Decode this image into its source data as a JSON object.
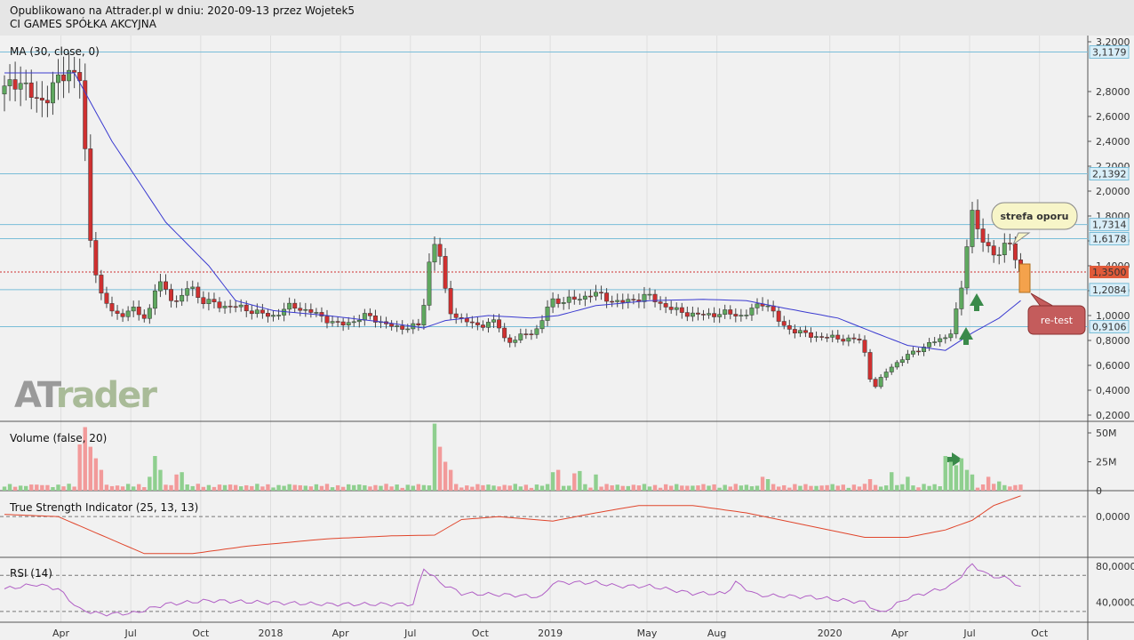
{
  "header": {
    "line1": "Opublikowano na Attrader.pl w dniu: 2020-09-13 przez Wojetek5",
    "line2": "CI GAMES SPÓŁKA AKCYJNA"
  },
  "logo": {
    "text_a": "AT",
    "text_b": "Trader"
  },
  "colors": {
    "up": "#5fa85f",
    "down": "#d03030",
    "vol_up": "#8fcf8f",
    "vol_down": "#f29a9a",
    "ma": "#3a3ad0",
    "tsi": "#e0452b",
    "rsi": "#b05fc5",
    "hline": "#79bdd8",
    "price_line": "#d03030"
  },
  "annotations": {
    "resistance": "strefa oporu",
    "retest": "re-test"
  },
  "chart_data": [
    {
      "type": "candlestick",
      "title": "MA (30, close, 0)",
      "y_ticks": [
        "3,2000",
        "2,8000",
        "2,6000",
        "2,4000",
        "2,2000",
        "2,0000",
        "1,8000",
        "1,6000",
        "1,4000",
        "1,2000",
        "1,0000",
        "0,8000",
        "0,6000",
        "0,4000",
        "0,2000"
      ],
      "y_tick_values": [
        3.2,
        2.8,
        2.6,
        2.4,
        2.2,
        2.0,
        1.8,
        1.6,
        1.4,
        1.2,
        1.0,
        0.8,
        0.6,
        0.4,
        0.2
      ],
      "ylim": [
        0.15,
        3.25
      ],
      "x_ticks": [
        "Apr",
        "Jul",
        "Oct",
        "2018",
        "Apr",
        "Jul",
        "Oct",
        "2019",
        "May",
        "Aug",
        "2020",
        "Apr",
        "Jul",
        "Oct"
      ],
      "x_tick_weeks": [
        11,
        24,
        37,
        50,
        63,
        76,
        89,
        102,
        120,
        133,
        154,
        167,
        180,
        193
      ],
      "level_labels": [
        "3,1179",
        "2,1392",
        "1,7314",
        "1,6178",
        "1,2084",
        "0,9106"
      ],
      "level_values": [
        3.1179,
        2.1392,
        1.7314,
        1.6178,
        1.2084,
        0.9106
      ],
      "current_price_label": "1,3500",
      "current_price": 1.35,
      "weeks": 190,
      "anchors": [
        [
          0,
          2.78
        ],
        [
          3,
          2.92
        ],
        [
          6,
          2.72
        ],
        [
          9,
          2.78
        ],
        [
          11,
          2.92
        ],
        [
          13,
          3.0
        ],
        [
          15,
          2.85
        ],
        [
          16,
          1.72
        ],
        [
          17,
          1.52
        ],
        [
          18,
          1.2
        ],
        [
          20,
          1.05
        ],
        [
          22,
          1.0
        ],
        [
          24,
          1.05
        ],
        [
          27,
          0.98
        ],
        [
          29,
          1.28
        ],
        [
          31,
          1.17
        ],
        [
          33,
          1.1
        ],
        [
          35,
          1.26
        ],
        [
          37,
          1.12
        ],
        [
          41,
          1.08
        ],
        [
          45,
          1.06
        ],
        [
          50,
          0.99
        ],
        [
          54,
          1.08
        ],
        [
          58,
          1.02
        ],
        [
          63,
          0.92
        ],
        [
          68,
          1.0
        ],
        [
          73,
          0.9
        ],
        [
          78,
          0.92
        ],
        [
          80,
          1.6
        ],
        [
          81,
          1.6
        ],
        [
          83,
          1.05
        ],
        [
          85,
          0.98
        ],
        [
          88,
          0.92
        ],
        [
          92,
          0.95
        ],
        [
          94,
          0.78
        ],
        [
          98,
          0.86
        ],
        [
          100,
          0.9
        ],
        [
          102,
          1.12
        ],
        [
          106,
          1.12
        ],
        [
          110,
          1.18
        ],
        [
          115,
          1.1
        ],
        [
          120,
          1.16
        ],
        [
          125,
          1.04
        ],
        [
          130,
          1.0
        ],
        [
          134,
          1.02
        ],
        [
          138,
          1.0
        ],
        [
          142,
          1.12
        ],
        [
          145,
          0.92
        ],
        [
          150,
          0.84
        ],
        [
          155,
          0.82
        ],
        [
          160,
          0.8
        ],
        [
          162,
          0.4
        ],
        [
          165,
          0.58
        ],
        [
          170,
          0.72
        ],
        [
          174,
          0.8
        ],
        [
          176,
          0.84
        ],
        [
          177,
          0.9
        ],
        [
          178,
          1.16
        ],
        [
          179,
          1.25
        ],
        [
          180,
          1.92
        ],
        [
          181,
          1.78
        ],
        [
          182,
          1.62
        ],
        [
          183,
          1.55
        ],
        [
          184,
          1.5
        ],
        [
          186,
          1.53
        ],
        [
          187,
          1.58
        ],
        [
          188,
          1.55
        ],
        [
          189,
          1.35
        ]
      ],
      "ma_anchors": [
        [
          0,
          2.95
        ],
        [
          13,
          2.95
        ],
        [
          20,
          2.4
        ],
        [
          30,
          1.75
        ],
        [
          38,
          1.4
        ],
        [
          43,
          1.12
        ],
        [
          50,
          1.04
        ],
        [
          60,
          1.0
        ],
        [
          70,
          0.95
        ],
        [
          78,
          0.9
        ],
        [
          82,
          0.96
        ],
        [
          90,
          1.0
        ],
        [
          98,
          0.98
        ],
        [
          103,
          1.0
        ],
        [
          110,
          1.08
        ],
        [
          120,
          1.12
        ],
        [
          130,
          1.13
        ],
        [
          138,
          1.12
        ],
        [
          145,
          1.06
        ],
        [
          155,
          0.98
        ],
        [
          162,
          0.86
        ],
        [
          168,
          0.76
        ],
        [
          175,
          0.72
        ],
        [
          180,
          0.86
        ],
        [
          185,
          0.98
        ],
        [
          189,
          1.12
        ]
      ]
    },
    {
      "type": "bar",
      "title": "Volume (false, 20)",
      "y_ticks": [
        "50M",
        "25M",
        "0"
      ],
      "y_tick_values": [
        50,
        25,
        0
      ],
      "ylim": [
        0,
        60
      ],
      "spikes": [
        [
          14,
          40
        ],
        [
          15,
          55
        ],
        [
          16,
          38
        ],
        [
          17,
          28
        ],
        [
          18,
          18
        ],
        [
          27,
          12
        ],
        [
          28,
          30
        ],
        [
          29,
          18
        ],
        [
          32,
          14
        ],
        [
          33,
          16
        ],
        [
          80,
          58
        ],
        [
          81,
          38
        ],
        [
          82,
          25
        ],
        [
          83,
          18
        ],
        [
          102,
          16
        ],
        [
          103,
          18
        ],
        [
          106,
          15
        ],
        [
          107,
          17
        ],
        [
          110,
          14
        ],
        [
          141,
          12
        ],
        [
          142,
          10
        ],
        [
          161,
          10
        ],
        [
          165,
          16
        ],
        [
          168,
          12
        ],
        [
          175,
          30
        ],
        [
          176,
          25
        ],
        [
          177,
          22
        ],
        [
          178,
          28
        ],
        [
          179,
          18
        ],
        [
          180,
          14
        ],
        [
          183,
          12
        ],
        [
          185,
          8
        ]
      ]
    },
    {
      "type": "line",
      "title": "True Strength Indicator (25, 13, 13)",
      "y_ticks": [
        "0,0000"
      ],
      "y_tick_values": [
        0
      ],
      "ylim": [
        -0.55,
        0.35
      ],
      "anchors": [
        [
          0,
          0.03
        ],
        [
          10,
          0.0
        ],
        [
          18,
          -0.25
        ],
        [
          26,
          -0.5
        ],
        [
          35,
          -0.5
        ],
        [
          45,
          -0.4
        ],
        [
          60,
          -0.3
        ],
        [
          72,
          -0.26
        ],
        [
          80,
          -0.25
        ],
        [
          85,
          -0.04
        ],
        [
          92,
          0.0
        ],
        [
          102,
          -0.06
        ],
        [
          110,
          0.05
        ],
        [
          118,
          0.15
        ],
        [
          128,
          0.15
        ],
        [
          138,
          0.05
        ],
        [
          150,
          -0.13
        ],
        [
          160,
          -0.28
        ],
        [
          168,
          -0.28
        ],
        [
          175,
          -0.18
        ],
        [
          180,
          -0.05
        ],
        [
          184,
          0.15
        ],
        [
          189,
          0.28
        ]
      ]
    },
    {
      "type": "line",
      "title": "RSI (14)",
      "y_ticks": [
        "80,0000",
        "40,0000"
      ],
      "y_tick_values": [
        80,
        40
      ],
      "ylim": [
        18,
        90
      ],
      "anchors": [
        [
          0,
          55
        ],
        [
          6,
          60
        ],
        [
          10,
          55
        ],
        [
          14,
          32
        ],
        [
          18,
          27
        ],
        [
          24,
          28
        ],
        [
          30,
          38
        ],
        [
          38,
          42
        ],
        [
          48,
          40
        ],
        [
          60,
          38
        ],
        [
          70,
          38
        ],
        [
          76,
          38
        ],
        [
          78,
          78
        ],
        [
          81,
          62
        ],
        [
          85,
          50
        ],
        [
          95,
          48
        ],
        [
          100,
          46
        ],
        [
          102,
          62
        ],
        [
          110,
          62
        ],
        [
          114,
          58
        ],
        [
          120,
          58
        ],
        [
          128,
          50
        ],
        [
          134,
          50
        ],
        [
          136,
          62
        ],
        [
          140,
          48
        ],
        [
          150,
          46
        ],
        [
          160,
          40
        ],
        [
          163,
          28
        ],
        [
          168,
          45
        ],
        [
          176,
          58
        ],
        [
          180,
          82
        ],
        [
          183,
          70
        ],
        [
          187,
          66
        ],
        [
          189,
          56
        ]
      ]
    }
  ]
}
